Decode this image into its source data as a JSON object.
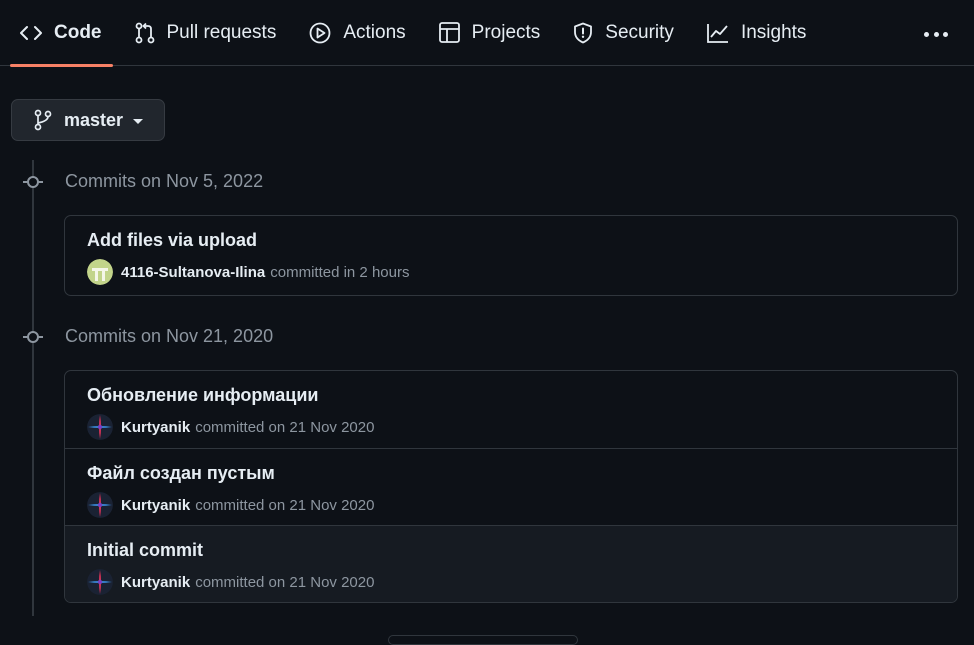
{
  "nav": {
    "tabs": [
      {
        "label": "Code",
        "icon": "code-icon",
        "active": true
      },
      {
        "label": "Pull requests",
        "icon": "git-pull-request-icon"
      },
      {
        "label": "Actions",
        "icon": "play-icon"
      },
      {
        "label": "Projects",
        "icon": "table-icon"
      },
      {
        "label": "Security",
        "icon": "shield-icon"
      },
      {
        "label": "Insights",
        "icon": "graph-icon"
      }
    ],
    "more_icon": "kebab-horizontal-icon",
    "active_underline_color": "#f78166"
  },
  "branch": {
    "name": "master",
    "icon": "git-branch-icon"
  },
  "groups": [
    {
      "title": "Commits on Nov 5, 2022",
      "commits": [
        {
          "message": "Add files via upload",
          "author": "4116-Sultanova-Ilina",
          "time": "committed in 2 hours",
          "avatar": "identicon-green"
        }
      ]
    },
    {
      "title": "Commits on Nov 21, 2020",
      "commits": [
        {
          "message": "Обновление информации",
          "author": "Kurtyanik",
          "time": "committed on 21 Nov 2020",
          "avatar": "cross-logo"
        },
        {
          "message": "Файл создан пустым",
          "author": "Kurtyanik",
          "time": "committed on 21 Nov 2020",
          "avatar": "cross-logo"
        },
        {
          "message": "Initial commit",
          "author": "Kurtyanik",
          "time": "committed on 21 Nov 2020",
          "avatar": "cross-logo"
        }
      ]
    }
  ],
  "colors": {
    "background": "#0d1117",
    "border": "#30363d",
    "muted_text": "#8d96a0",
    "text": "#e6edf3"
  }
}
